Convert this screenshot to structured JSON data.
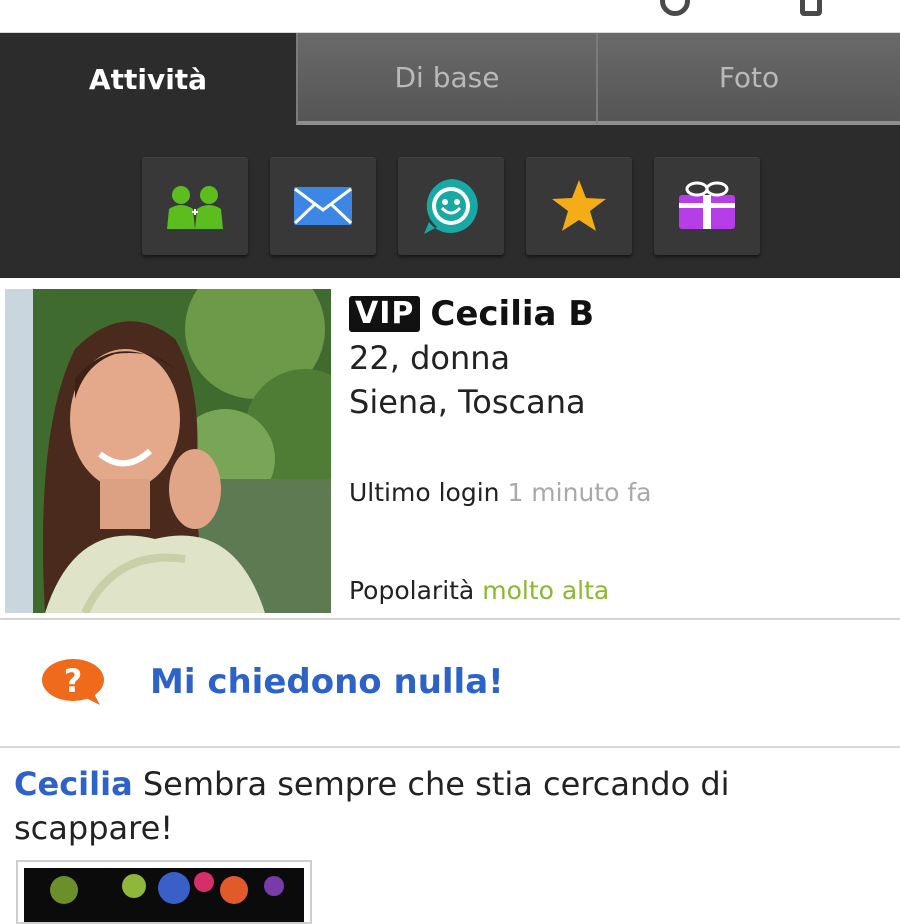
{
  "header": {
    "logo_fragment": ""
  },
  "tabs": [
    {
      "label": "Attività",
      "active": true
    },
    {
      "label": "Di base",
      "active": false
    },
    {
      "label": "Foto",
      "active": false
    }
  ],
  "actions": [
    {
      "icon": "friends-icon",
      "color": "#5bbd1e"
    },
    {
      "icon": "envelope-icon",
      "color": "#3c86e6"
    },
    {
      "icon": "smiley-chat-icon",
      "color": "#19a9a4"
    },
    {
      "icon": "star-icon",
      "color": "#f4ad16"
    },
    {
      "icon": "gift-icon",
      "color": "#b63ee8"
    }
  ],
  "profile": {
    "vip_badge": "VIP",
    "name": "Cecilia B",
    "age_gender": "22, donna",
    "location": "Siena, Toscana",
    "last_login_label": "Ultimo login",
    "last_login_value": "1 minuto fa",
    "popularity_label": "Popolarità",
    "popularity_value": "molto alta"
  },
  "question": {
    "icon": "question-bubble-icon",
    "text": "Mi chiedono nulla!"
  },
  "post": {
    "author": "Cecilia",
    "text": "Sembra sempre che stia cercando di scappare!"
  },
  "colors": {
    "link_blue": "#2d63c8",
    "popularity_green": "#8ab92b",
    "question_orange": "#ef6a1a",
    "dark_panel": "#2c2c2c"
  }
}
